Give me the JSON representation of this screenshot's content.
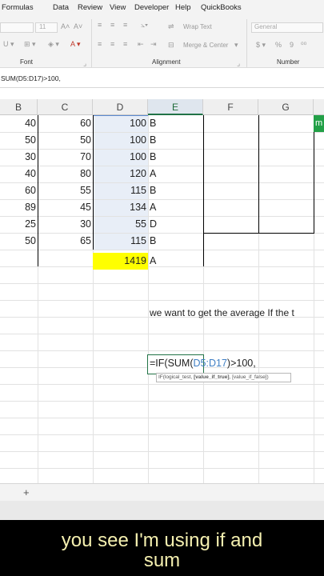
{
  "menu": [
    "Formulas",
    "Data",
    "Review",
    "View",
    "Developer",
    "Help",
    "QuickBooks"
  ],
  "ribbon": {
    "font_size": "11",
    "wrap_text": "Wrap Text",
    "merge_center": "Merge & Center",
    "number_format": "General",
    "group_font": "Font",
    "group_alignment": "Alignment",
    "group_number": "Number"
  },
  "formula_bar": {
    "text": "SUM(D5:D17)>100,"
  },
  "columns": [
    "B",
    "C",
    "D",
    "E",
    "F",
    "G"
  ],
  "rows": [
    {
      "b": "40",
      "c": "60",
      "d": "100",
      "e": "B"
    },
    {
      "b": "50",
      "c": "50",
      "d": "100",
      "e": "B"
    },
    {
      "b": "30",
      "c": "70",
      "d": "100",
      "e": "B"
    },
    {
      "b": "40",
      "c": "80",
      "d": "120",
      "e": "A"
    },
    {
      "b": "60",
      "c": "55",
      "d": "115",
      "e": "B"
    },
    {
      "b": "89",
      "c": "45",
      "d": "134",
      "e": "A"
    },
    {
      "b": "25",
      "c": "30",
      "d": "55",
      "e": "D"
    },
    {
      "b": "50",
      "c": "65",
      "d": "115",
      "e": "B"
    }
  ],
  "total": {
    "d": "1419",
    "e": "A"
  },
  "h_cell_fragment": "m",
  "note": "we want to get the average If the t",
  "formula_cell": {
    "pre": "=IF(SUM(",
    "ref": "D5:D17",
    "post": ")>100,"
  },
  "tooltip": {
    "a": "IF(logical_test, ",
    "b": "[value_if_true]",
    "c": ", [value_if_false])"
  },
  "add_sheet": "+",
  "caption": {
    "line1": "you see I'm using if and",
    "line2": "sum"
  },
  "colors": {
    "accent": "#217346",
    "highlight": "#ffff00",
    "caption_text": "#f5f0b0",
    "ref_blue": "#3f7fc4"
  }
}
